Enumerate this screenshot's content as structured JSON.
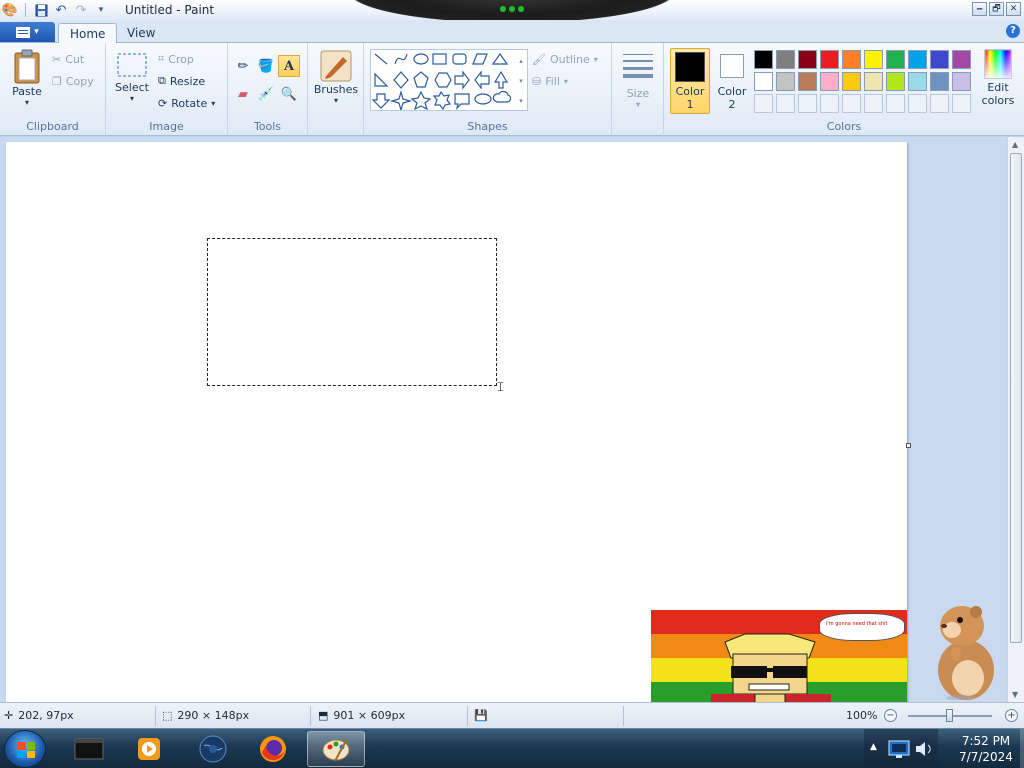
{
  "window": {
    "title": "Untitled - Paint",
    "controls": {
      "minimize": "🗕",
      "restore": "🗗",
      "close": "✕"
    }
  },
  "ribbon": {
    "tabs": [
      {
        "label": "Home",
        "active": true
      },
      {
        "label": "View",
        "active": false
      }
    ],
    "help": "?",
    "clipboard": {
      "label": "Clipboard",
      "paste": "Paste",
      "cut": "Cut",
      "copy": "Copy"
    },
    "image": {
      "label": "Image",
      "select": "Select",
      "crop": "Crop",
      "resize": "Resize",
      "rotate": "Rotate"
    },
    "tools": {
      "label": "Tools"
    },
    "brushes": {
      "label": "Brushes"
    },
    "shapes": {
      "label": "Shapes",
      "outline": "Outline",
      "fill": "Fill"
    },
    "size": {
      "label": "Size"
    },
    "colors": {
      "label": "Colors",
      "color1": {
        "label": "Color",
        "num": "1",
        "value": "#000000"
      },
      "color2": {
        "label": "Color",
        "num": "2",
        "value": "#ffffff"
      },
      "edit": {
        "line1": "Edit",
        "line2": "colors"
      },
      "palette_row1": [
        "#000000",
        "#7f7f7f",
        "#880015",
        "#ed1c24",
        "#ff7f27",
        "#fff200",
        "#22b14c",
        "#00a2e8",
        "#3f48cc",
        "#a349a4"
      ],
      "palette_row2": [
        "#ffffff",
        "#c3c3c3",
        "#b97a57",
        "#ffaec9",
        "#ffc90e",
        "#efe4b0",
        "#b5e61d",
        "#99d9ea",
        "#7092be",
        "#c8bfe7"
      ]
    }
  },
  "canvas": {
    "comic_stripes": [
      "#e02a1a",
      "#f08a14",
      "#f2e21a",
      "#2a9e2a"
    ],
    "bubble_text": "i'm gonna need that shit"
  },
  "status": {
    "cursor_pos": "202, 97px",
    "selection_size": "290 × 148px",
    "image_size": "901 × 609px",
    "zoom": "100%",
    "zoom_minus": "−",
    "zoom_plus": "+"
  },
  "taskbar": {
    "time": "7:52 PM",
    "date": "7/7/2024"
  }
}
